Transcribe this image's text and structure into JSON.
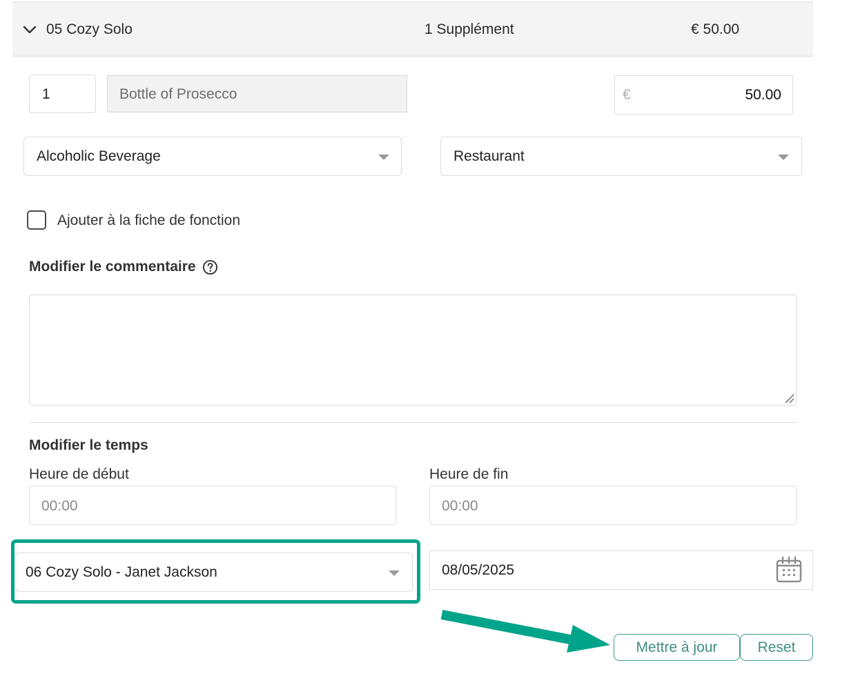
{
  "group": {
    "title": "05 Cozy Solo",
    "count_label": "1 Supplément",
    "total": "€ 50.00"
  },
  "item": {
    "quantity": "1",
    "name": "Bottle of Prosecco",
    "currency_symbol": "€",
    "price": "50.00"
  },
  "selects": {
    "category": "Alcoholic Beverage",
    "outlet": "Restaurant"
  },
  "function_sheet": {
    "checkbox_label": "Ajouter à la fiche de fonction",
    "checked": false
  },
  "comment": {
    "heading": "Modifier le commentaire",
    "value": ""
  },
  "time": {
    "heading": "Modifier le temps",
    "start_label": "Heure de début",
    "start_placeholder": "00:00",
    "end_label": "Heure de fin",
    "end_placeholder": "00:00"
  },
  "assignment": {
    "room_select": "06 Cozy Solo - Janet Jackson",
    "date": "08/05/2025"
  },
  "actions": {
    "update_label": "Mettre à jour",
    "reset_label": "Reset"
  },
  "colors": {
    "highlight": "#00a48a",
    "button_border": "#3e9a8f",
    "header_bg": "#f4f4f4"
  },
  "icons": {
    "collapse": "chevron-down-icon",
    "help": "question-circle-icon",
    "calendar": "calendar-icon",
    "dropdown": "caret-down-icon",
    "annotation": "arrow-right-icon"
  }
}
